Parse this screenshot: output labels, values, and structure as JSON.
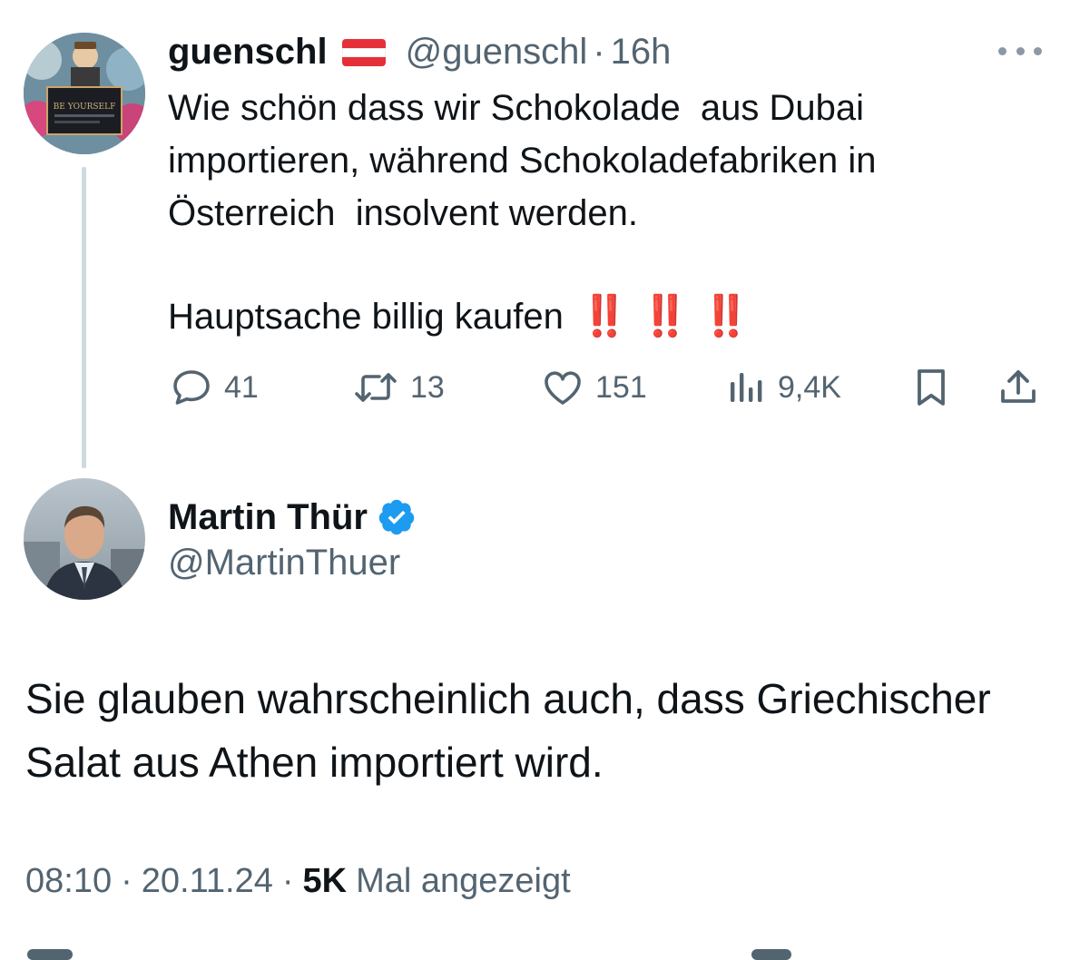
{
  "colors": {
    "text": "#0f1419",
    "secondary": "#536471",
    "thread_line": "#cfd9de",
    "verified_blue": "#1d9bf0",
    "exclamation_red": "#e0242d"
  },
  "parent_tweet": {
    "display_name": "guenschl",
    "flag_icon": "austria-flag-icon",
    "handle": "@guenschl",
    "dot": "·",
    "time": "16h",
    "more_icon": "more-horizontal-icon",
    "avatar_icon": "user-avatar",
    "text": "Wie schön dass wir Schokolade  aus Dubai importieren, während Schokoladefabriken in Österreich  insolvent werden.",
    "text_line2": "Hauptsache billig kaufen",
    "emoji": [
      "‼️",
      "‼️",
      "‼️"
    ],
    "actions": {
      "reply": {
        "icon": "reply-icon",
        "count": "41"
      },
      "retweet": {
        "icon": "retweet-icon",
        "count": "13"
      },
      "like": {
        "icon": "heart-icon",
        "count": "151"
      },
      "views": {
        "icon": "views-chart-icon",
        "count": "9,4K"
      },
      "bookmark": {
        "icon": "bookmark-icon"
      },
      "share": {
        "icon": "share-icon"
      }
    }
  },
  "reply_tweet": {
    "display_name": "Martin Thür",
    "verified_icon": "verified-badge-icon",
    "handle": "@MartinThuer",
    "avatar_icon": "user-avatar",
    "text": "Sie glauben wahrscheinlich auch, dass Griechischer Salat aus Athen importiert wird.",
    "time": "08:10",
    "sep": "·",
    "date": "20.11.24",
    "views_count": "5K",
    "views_label": "Mal angezeigt"
  }
}
